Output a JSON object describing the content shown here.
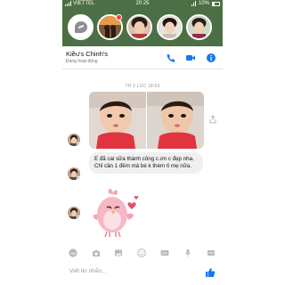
{
  "status_bar": {
    "carrier": "VIETTEL",
    "time": "20:25",
    "battery": "10%"
  },
  "chat_heads": [
    {
      "name": "messenger",
      "icon": "messenger-icon"
    },
    {
      "name": "contact-1"
    },
    {
      "name": "contact-2"
    },
    {
      "name": "contact-3"
    },
    {
      "name": "contact-4"
    }
  ],
  "header": {
    "contact_name": "Kiều's Chinh's",
    "contact_status": "Đang hoạt động",
    "icons": [
      "phone-icon",
      "video-icon",
      "info-icon"
    ]
  },
  "conversation": {
    "timestamp": "TH 2 LÚC 18:03",
    "message_text": "E đã cai sữa thành công c.ơn c đẹp nha. Chỉ cần 1 đêm mà bé k thèm tí mẹ nữa."
  },
  "composer": {
    "placeholder": "Viết tin nhắn...",
    "tools": [
      "aa-icon",
      "camera-icon",
      "image-icon",
      "emoji-icon",
      "gif-icon",
      "mic-icon",
      "more-icon"
    ]
  },
  "colors": {
    "accent": "#1877f2",
    "topbar": "#4d6f45",
    "bubble": "#f1f0f0"
  }
}
